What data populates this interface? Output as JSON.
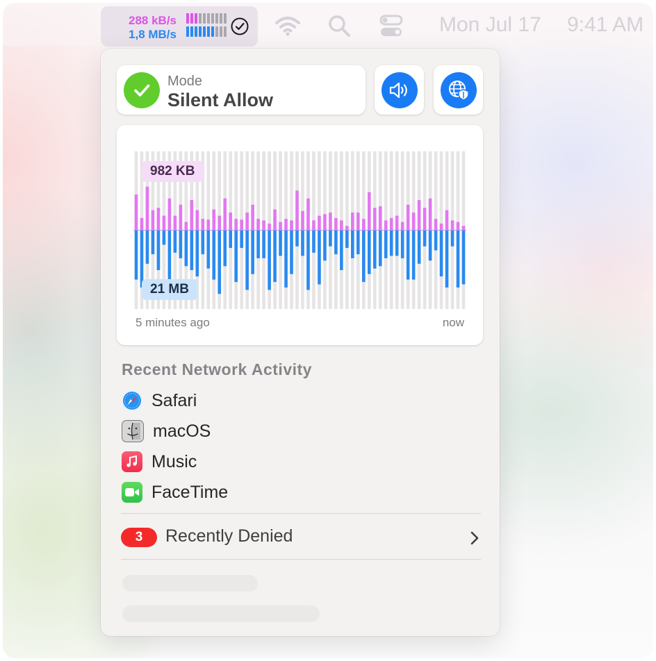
{
  "menubar": {
    "upload_speed": "288 kB/s",
    "download_speed": "1,8 MB/s",
    "upload_meter_level": 0.25,
    "download_meter_level": 0.7,
    "date": "Mon Jul 17",
    "time": "9:41 AM",
    "icons": [
      "check-circle-icon",
      "wifi-icon",
      "search-icon",
      "control-center-icon"
    ]
  },
  "mode": {
    "label": "Mode",
    "value": "Silent Allow",
    "icon": "checkmark-icon",
    "accent": "#61cd2d"
  },
  "quick_buttons": {
    "sound_icon": "speaker-icon",
    "vpn_icon": "globe-shield-icon",
    "accent": "#1a7cf4"
  },
  "traffic_chart": {
    "upload_peak": "982 KB",
    "download_peak": "21 MB",
    "x_start_label": "5 minutes ago",
    "x_end_label": "now"
  },
  "chart_data": {
    "type": "bar",
    "bars": 60,
    "upload_color": "#e277f0",
    "download_color": "#2a8af0",
    "upload": [
      0.45,
      0.15,
      0.55,
      0.25,
      0.28,
      0.18,
      0.4,
      0.18,
      0.32,
      0.1,
      0.38,
      0.25,
      0.14,
      0.13,
      0.26,
      0.18,
      0.4,
      0.22,
      0.14,
      0.13,
      0.22,
      0.32,
      0.14,
      0.12,
      0.08,
      0.26,
      0.1,
      0.14,
      0.12,
      0.5,
      0.24,
      0.4,
      0.12,
      0.18,
      0.2,
      0.22,
      0.15,
      0.12,
      0.05,
      0.22,
      0.22,
      0.14,
      0.48,
      0.28,
      0.3,
      0.12,
      0.15,
      0.18,
      0.1,
      0.32,
      0.22,
      0.38,
      0.28,
      0.4,
      0.14,
      0.08,
      0.25,
      0.12,
      0.1,
      0.05
    ],
    "download": [
      0.62,
      0.72,
      0.42,
      0.3,
      0.5,
      0.18,
      0.7,
      0.28,
      0.35,
      0.45,
      0.5,
      0.58,
      0.3,
      0.48,
      0.62,
      0.8,
      0.45,
      0.22,
      0.65,
      0.22,
      0.75,
      0.55,
      0.35,
      0.35,
      0.75,
      0.65,
      0.32,
      0.72,
      0.55,
      0.2,
      0.32,
      0.75,
      0.28,
      0.68,
      0.38,
      0.2,
      0.3,
      0.5,
      0.22,
      0.35,
      0.3,
      0.65,
      0.55,
      0.48,
      0.45,
      0.35,
      0.32,
      0.32,
      0.35,
      0.62,
      0.62,
      0.42,
      0.2,
      0.38,
      0.25,
      0.58,
      0.72,
      0.2,
      0.72,
      0.68
    ]
  },
  "recent_activity": {
    "title": "Recent Network Activity",
    "apps": [
      {
        "name": "Safari",
        "icon": "safari-icon"
      },
      {
        "name": "macOS",
        "icon": "finder-icon"
      },
      {
        "name": "Music",
        "icon": "music-icon"
      },
      {
        "name": "FaceTime",
        "icon": "facetime-icon"
      }
    ]
  },
  "denied": {
    "count": "3",
    "label": "Recently Denied",
    "badge_color": "#f42a2a"
  }
}
